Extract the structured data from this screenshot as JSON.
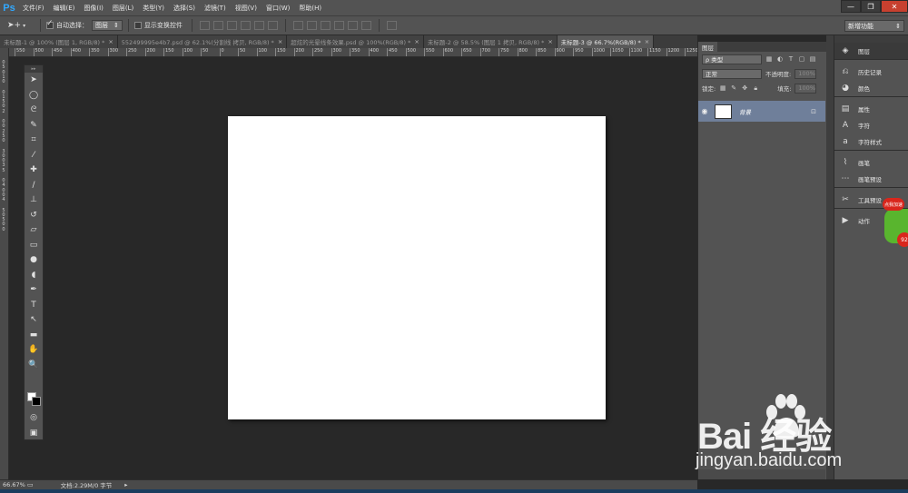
{
  "app": {
    "logo": "Ps"
  },
  "menu": [
    "文件(F)",
    "编辑(E)",
    "图像(I)",
    "图层(L)",
    "类型(Y)",
    "选择(S)",
    "滤镜(T)",
    "视图(V)",
    "窗口(W)",
    "帮助(H)"
  ],
  "window_controls": {
    "minimize": "—",
    "restore": "❐",
    "close": "✕"
  },
  "options": {
    "auto_select_label": "自动选择：",
    "auto_select_checked": true,
    "auto_select_target": "图层",
    "show_transform_label": "显示变换控件",
    "show_transform_checked": false,
    "workspace": "新增功能"
  },
  "tabs": [
    {
      "label": "未标题-1 @ 100% (图层 1, RGB/8) *",
      "active": false
    },
    {
      "label": "552499995e4b7.psd @ 62.1%(分割线 拷贝, RGB/8) *",
      "active": false
    },
    {
      "label": "超炫的光晕线条效果.psd @ 100%(RGB/8) *",
      "active": false
    },
    {
      "label": "未标题-2 @ 58.5% (图层 1 拷贝, RGB/8) *",
      "active": false
    },
    {
      "label": "未标题-3 @ 66.7%(RGB/8) *",
      "active": true
    }
  ],
  "ruler_top": [
    "550",
    "500",
    "450",
    "400",
    "350",
    "300",
    "250",
    "200",
    "150",
    "100",
    "50",
    "0",
    "50",
    "100",
    "150",
    "200",
    "250",
    "300",
    "350",
    "400",
    "450",
    "500",
    "550",
    "600",
    "650",
    "700",
    "750",
    "800",
    "850",
    "900",
    "950",
    "1000",
    "1050",
    "1100",
    "1150",
    "1200",
    "1250"
  ],
  "ruler_left": [
    "0",
    "5",
    "0",
    "1",
    "0",
    "0",
    "1",
    "5",
    "0",
    "2",
    "0",
    "0",
    "2",
    "5",
    "0",
    "3",
    "0",
    "0",
    "3",
    "5",
    "0",
    "4",
    "0",
    "0",
    "4",
    "5",
    "0",
    "5",
    "0",
    "0"
  ],
  "tools": [
    {
      "name": "move-tool-icon",
      "glyph": "➤"
    },
    {
      "name": "ellipse-marquee-icon",
      "glyph": "◯"
    },
    {
      "name": "lasso-icon",
      "glyph": "ᘓ"
    },
    {
      "name": "quick-select-icon",
      "glyph": "✎"
    },
    {
      "name": "crop-icon",
      "glyph": "⌗"
    },
    {
      "name": "eyedropper-icon",
      "glyph": "⁄"
    },
    {
      "name": "healing-brush-icon",
      "glyph": "✚"
    },
    {
      "name": "brush-icon",
      "glyph": "∕"
    },
    {
      "name": "clone-stamp-icon",
      "glyph": "⊥"
    },
    {
      "name": "history-brush-icon",
      "glyph": "↺"
    },
    {
      "name": "eraser-icon",
      "glyph": "▱"
    },
    {
      "name": "gradient-icon",
      "glyph": "▭"
    },
    {
      "name": "blur-icon",
      "glyph": "●"
    },
    {
      "name": "dodge-icon",
      "glyph": "◖"
    },
    {
      "name": "pen-icon",
      "glyph": "✒"
    },
    {
      "name": "type-icon",
      "glyph": "T"
    },
    {
      "name": "path-select-icon",
      "glyph": "↖"
    },
    {
      "name": "rectangle-icon",
      "glyph": "▬"
    },
    {
      "name": "hand-icon",
      "glyph": "✋"
    },
    {
      "name": "zoom-icon",
      "glyph": "🔍"
    }
  ],
  "status": {
    "zoom": "66.67%",
    "doc": "文档:2.29M/0 字节",
    "arrow": "▸"
  },
  "layers_panel": {
    "tab_label": "图层",
    "filter_label": "ρ 类型",
    "blend_mode": "正常",
    "opacity_label": "不透明度:",
    "opacity_value": "100%",
    "lock_label": "锁定:",
    "fill_label": "填充:",
    "fill_value": "100%",
    "layer_name": "背景"
  },
  "dock": [
    {
      "label": "图层",
      "icon": "layers-icon",
      "glyph": "◈",
      "active": true
    },
    {
      "label": "历史记录",
      "icon": "history-icon",
      "glyph": "⎌",
      "active": false
    },
    {
      "label": "颜色",
      "icon": "color-icon",
      "glyph": "◕",
      "active": false
    },
    {
      "label": "属性",
      "icon": "properties-icon",
      "glyph": "▤",
      "active": false
    },
    {
      "label": "字符",
      "icon": "character-icon",
      "glyph": "A",
      "active": false
    },
    {
      "label": "字符样式",
      "icon": "character-style-icon",
      "glyph": "a",
      "active": false
    },
    {
      "label": "画笔",
      "icon": "brush-panel-icon",
      "glyph": "⌇",
      "active": false
    },
    {
      "label": "画笔预设",
      "icon": "brush-presets-icon",
      "glyph": "⋯",
      "active": false
    },
    {
      "label": "工具预设",
      "icon": "tool-presets-icon",
      "glyph": "✂",
      "active": false
    },
    {
      "label": "动作",
      "icon": "actions-icon",
      "glyph": "▶",
      "active": false
    }
  ],
  "widget": {
    "badge": "点我加速",
    "count": "92"
  },
  "watermark": {
    "brand": "Bai  经验",
    "site": "jingyan.baidu.com"
  }
}
